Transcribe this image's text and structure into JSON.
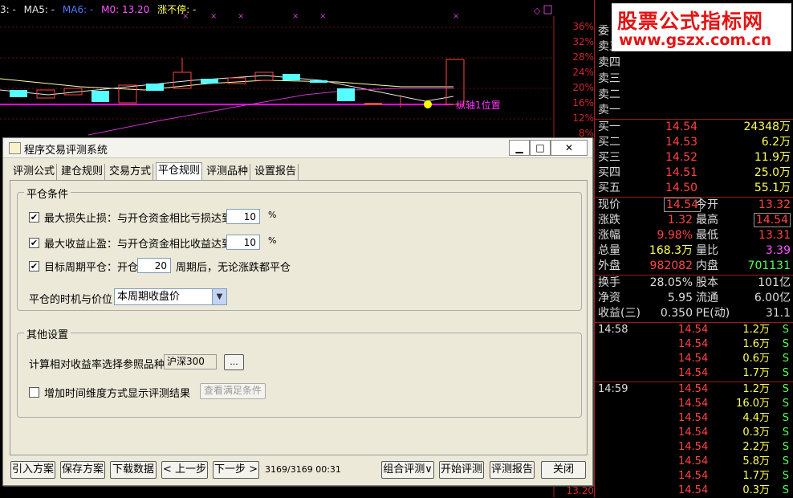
{
  "chart": {
    "legend": [
      {
        "text": "3: -",
        "color": "#e6e6e6"
      },
      {
        "text": "MA5: -",
        "color": "#e6e6e6"
      },
      {
        "text": "MA6: -",
        "color": "#ffff55"
      },
      {
        "text": "M0: 13.20",
        "color": "#ff55ff"
      },
      {
        "text": "涨不停: -",
        "color": "#ffff55"
      }
    ],
    "axis_labels": [
      "36%",
      "32%",
      "28%",
      "24%",
      "20%",
      "16%",
      "12%",
      "8%",
      "13.20"
    ],
    "annotation": "纵轴1位置",
    "colors": {
      "up": "#ff4444",
      "down": "#55ffff",
      "pivot": "#ff00ff",
      "ma": "#ffffaa",
      "dot": "#ffff00"
    }
  },
  "panel": {
    "top_label": "委",
    "sell5_label": "卖五",
    "asks": [
      {
        "label": "卖四"
      },
      {
        "label": "卖三"
      },
      {
        "label": "卖二"
      },
      {
        "label": "卖一"
      }
    ],
    "bids": [
      {
        "label": "买一",
        "price": "14.54",
        "vol": "24348万"
      },
      {
        "label": "买二",
        "price": "14.53",
        "vol": "6.2万"
      },
      {
        "label": "买三",
        "price": "14.52",
        "vol": "11.9万"
      },
      {
        "label": "买四",
        "price": "14.51",
        "vol": "25.0万"
      },
      {
        "label": "买五",
        "price": "14.50",
        "vol": "55.1万"
      }
    ],
    "quote": [
      {
        "l1": "现价",
        "v1": "14.54",
        "l2": "今开",
        "v2": "13.32"
      },
      {
        "l1": "涨跌",
        "v1": "1.32",
        "l2": "最高",
        "v2": "14.54"
      },
      {
        "l1": "涨幅",
        "v1": "9.98%",
        "l2": "最低",
        "v2": "13.31"
      },
      {
        "l1": "总量",
        "v1": "168.3万",
        "l2": "量比",
        "v2": "3.39"
      },
      {
        "l1": "外盘",
        "v1": "982082",
        "l2": "内盘",
        "v2": "701131"
      }
    ],
    "fund": [
      {
        "l1": "换手",
        "v1": "28.05%",
        "l2": "股本",
        "v2": "101亿"
      },
      {
        "l1": "净资",
        "v1": "5.95",
        "l2": "流通",
        "v2": "6.00亿"
      },
      {
        "l1": "收益(三)",
        "v1": "0.350",
        "l2": "PE(动)",
        "v2": "31.1"
      }
    ],
    "ticks": [
      {
        "time": "14:58",
        "price": "14.54",
        "vol": "1.2万",
        "flag": "S"
      },
      {
        "time": "",
        "price": "14.54",
        "vol": "1.6万",
        "flag": "S"
      },
      {
        "time": "",
        "price": "14.54",
        "vol": "0.6万",
        "flag": "S"
      },
      {
        "time": "",
        "price": "14.54",
        "vol": "1.7万",
        "flag": "S"
      },
      {
        "time": "14:59",
        "price": "14.54",
        "vol": "1.2万",
        "flag": "S"
      },
      {
        "time": "",
        "price": "14.54",
        "vol": "16.0万",
        "flag": "S"
      },
      {
        "time": "",
        "price": "14.54",
        "vol": "4.4万",
        "flag": "S"
      },
      {
        "time": "",
        "price": "14.54",
        "vol": "0.3万",
        "flag": "S"
      },
      {
        "time": "",
        "price": "14.54",
        "vol": "2.2万",
        "flag": "S"
      },
      {
        "time": "",
        "price": "14.54",
        "vol": "5.8万",
        "flag": "S"
      },
      {
        "time": "",
        "price": "14.54",
        "vol": "1.7万",
        "flag": "S"
      },
      {
        "time": "",
        "price": "14.54",
        "vol": "0.3万",
        "flag": "S"
      }
    ]
  },
  "watermark": {
    "line1": "股票公式指标网",
    "line2": "www.gszx.com.cn"
  },
  "dialog": {
    "title": "程序交易评测系统",
    "tabs": [
      "评测公式",
      "建仓规则",
      "交易方式",
      "平仓规则",
      "评测品种",
      "设置报告"
    ],
    "active_tab": "平仓规则",
    "close_group": {
      "title": "平仓条件",
      "stop_loss": {
        "label": "最大损失止损：与开仓资金相比亏损达到",
        "value": "10",
        "unit": "%",
        "checked": true
      },
      "take_profit": {
        "label": "最大收益止盈：与开仓资金相比收益达到",
        "value": "10",
        "unit": "%",
        "checked": true
      },
      "period": {
        "label": "目标周期平仓：开仓",
        "value": "20",
        "suffix": "周期后，无论涨跌都平仓",
        "checked": true
      },
      "timing_label": "平仓的时机与价位",
      "timing_value": "本周期收盘价"
    },
    "other_group": {
      "title": "其他设置",
      "ref_label": "计算相对收益率选择参照品种",
      "ref_value": "沪深300",
      "ref_button": "...",
      "time_dim_label": "增加时间维度方式显示评测结果",
      "time_dim_checked": false,
      "view_button": "查看满足条件"
    },
    "footer": {
      "import": "引入方案",
      "save": "保存方案",
      "download": "下载数据",
      "prev": "< 上一步",
      "next": "下一步 >",
      "status": "3169/3169  00:31",
      "combo": "组合评测∨",
      "start": "开始评测",
      "report": "评测报告",
      "close": "关闭"
    }
  }
}
